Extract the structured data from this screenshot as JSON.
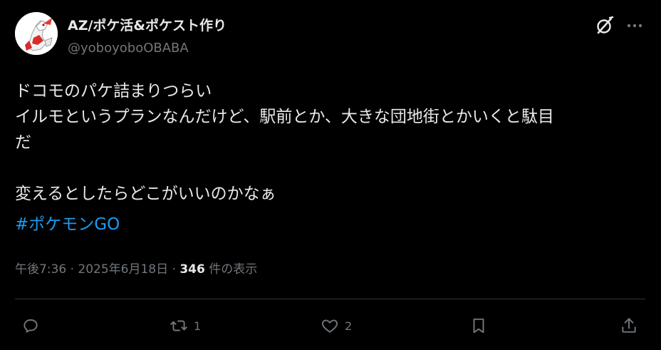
{
  "author": {
    "display_name": "AZ/ポケ活&ポケスト作り",
    "handle": "@yoboyoboOBABA",
    "avatar_icon": "pokemon-avatar-icon"
  },
  "header_icons": {
    "grok": "grok-icon",
    "more": "more-icon"
  },
  "tweet": {
    "lines": [
      "ドコモのパケ詰まりつらい",
      "イルモというプランなんだけど、駅前とか、大きな団地街とかいくと駄目",
      "だ",
      "",
      "変えるとしたらどこがいいのかなぁ"
    ],
    "hashtag": "#ポケモンGO"
  },
  "meta": {
    "time": "午後7:36",
    "separator1": " · ",
    "date": "2025年6月18日",
    "separator2": " · ",
    "views_count": "346",
    "views_label": " 件の表示"
  },
  "actions": {
    "reply": {
      "icon": "reply-icon",
      "count": ""
    },
    "repost": {
      "icon": "repost-icon",
      "count": "1"
    },
    "like": {
      "icon": "heart-icon",
      "count": "2"
    },
    "bookmark": {
      "icon": "bookmark-icon",
      "count": ""
    },
    "share": {
      "icon": "share-icon",
      "count": ""
    }
  },
  "colors": {
    "background": "#000000",
    "text": "#e7e9ea",
    "muted": "#71767b",
    "link": "#1d9bf0",
    "divider": "#2f3336"
  }
}
